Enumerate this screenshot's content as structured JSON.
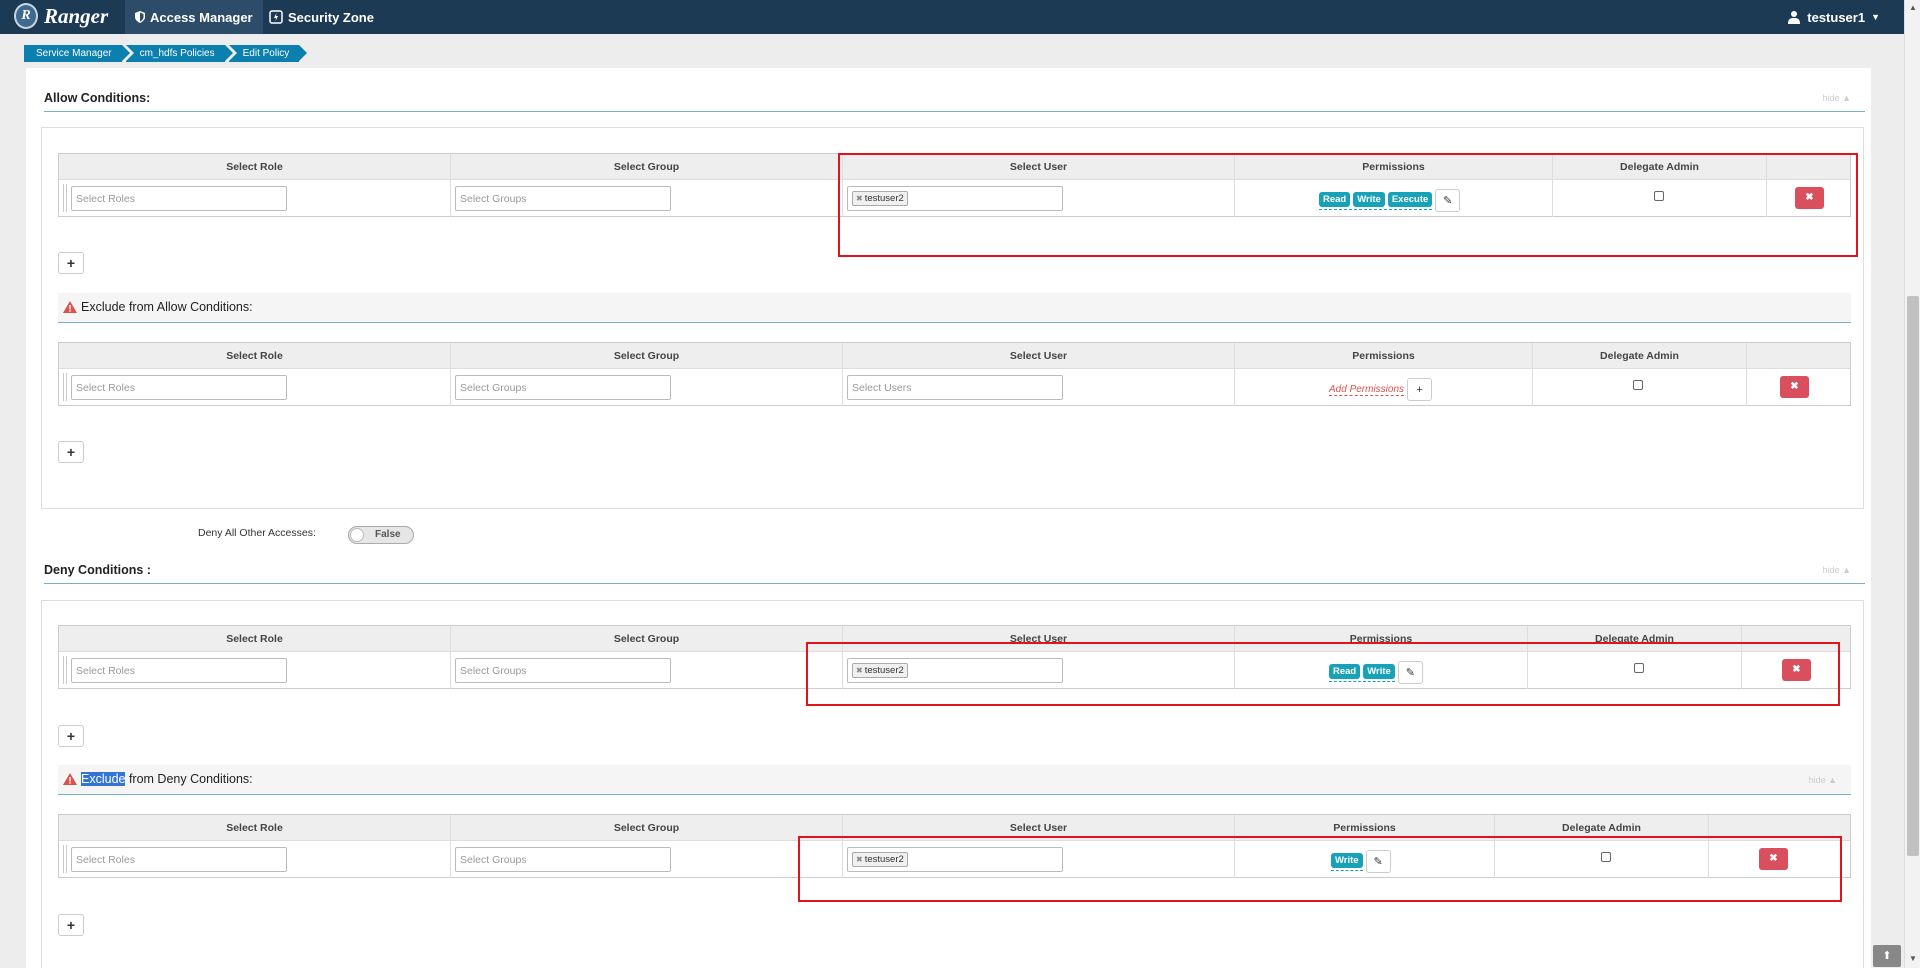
{
  "topbar": {
    "brand": "Ranger",
    "logo_letter": "R",
    "nav": [
      {
        "label": "Access Manager",
        "icon": "shield-icon"
      },
      {
        "label": "Security Zone",
        "icon": "zone-icon"
      }
    ],
    "user": "testuser1"
  },
  "breadcrumb": [
    "Service Manager",
    "cm_hdfs Policies",
    "Edit Policy"
  ],
  "allow": {
    "title": "Allow Conditions:",
    "hide": "hide"
  },
  "deny": {
    "title": "Deny Conditions :",
    "hide": "hide"
  },
  "columns": {
    "role": "Select Role",
    "group": "Select Group",
    "user": "Select User",
    "permissions": "Permissions",
    "delegate": "Delegate Admin"
  },
  "placeholders": {
    "roles": "Select Roles",
    "groups": "Select Groups",
    "users": "Select Users"
  },
  "rows": {
    "allow": {
      "user": "testuser2",
      "perms": [
        "Read",
        "Write",
        "Execute"
      ]
    },
    "allow_exclude": {
      "add_permissions": "Add Permissions"
    },
    "deny": {
      "user": "testuser2",
      "perms": [
        "Read",
        "Write"
      ]
    },
    "deny_exclude": {
      "user": "testuser2",
      "perms": [
        "Write"
      ]
    }
  },
  "exclude_allow": {
    "title": "Exclude from Allow Conditions:"
  },
  "exclude_deny": {
    "selected": "Exclude",
    "rest": " from Deny Conditions:",
    "hide": "hide"
  },
  "deny_all": {
    "label": "Deny All Other Accesses:",
    "value": "False"
  },
  "colors": {
    "topbar": "#1d3a55",
    "accent": "#0b7fad",
    "perm": "#18a2b8",
    "danger": "#da4f5e",
    "highlight": "#e0141a"
  }
}
